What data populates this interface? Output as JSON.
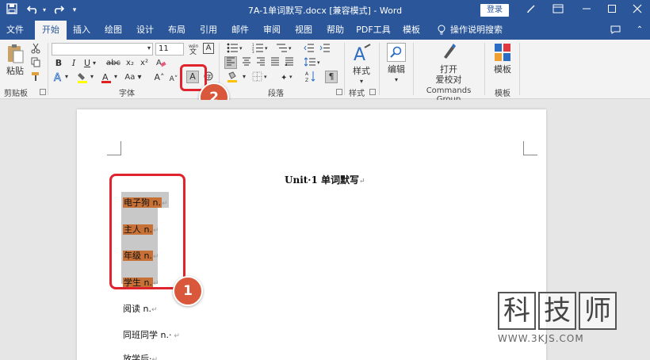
{
  "titlebar": {
    "title": "7A-1单词默写.docx [兼容模式] - Word",
    "login": "登录"
  },
  "tabs": [
    "文件",
    "开始",
    "插入",
    "绘图",
    "设计",
    "布局",
    "引用",
    "邮件",
    "审阅",
    "视图",
    "帮助",
    "PDF工具",
    "模板",
    "操作说明搜索"
  ],
  "ribbon": {
    "paste": "粘贴",
    "clipboard_group": "剪贴板",
    "font_size": "11",
    "font_group": "字体",
    "paragraph_group": "段落",
    "styles": "样式",
    "styles_group": "样式",
    "edit": "编辑",
    "open_line1": "打开",
    "open_line2": "爱校对",
    "commands_group": "Commands Group",
    "template": "模板",
    "template_group": "模板"
  },
  "document": {
    "title": "Unit·1 单词默写",
    "highlighted_items": [
      "电子狗 n.",
      "主人 n.",
      "年级 n.",
      "学生 n."
    ],
    "items": [
      "阅读 n.",
      "同班同学 n.·",
      "放学后·"
    ]
  },
  "annotations": {
    "badge_1": "1",
    "badge_2": "2"
  },
  "watermark": {
    "chars": [
      "科",
      "技",
      "师"
    ],
    "url": "WWW.3KJS.COM"
  },
  "colors": {
    "accent": "#2b579a",
    "highlight": "#c87137",
    "annotation_red": "#e0242e",
    "badge": "#d9573a"
  }
}
